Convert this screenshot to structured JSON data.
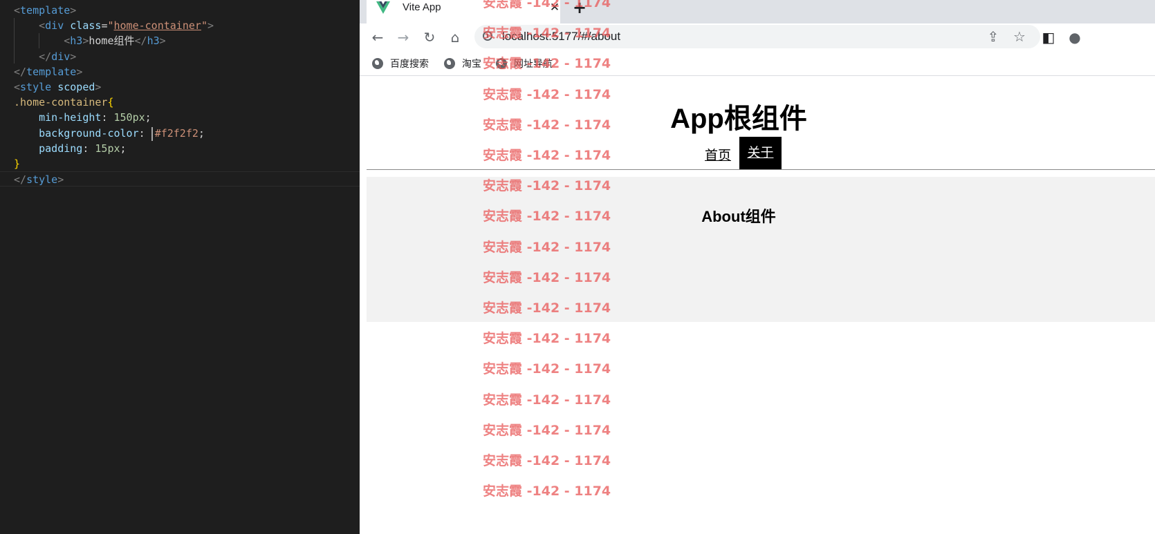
{
  "editor": {
    "lines": [
      [
        [
          "t-punc",
          "<"
        ],
        [
          "t-tag",
          "template"
        ],
        [
          "t-punc",
          ">"
        ]
      ],
      [
        [
          "t-text",
          "    "
        ],
        [
          "t-punc",
          "<"
        ],
        [
          "t-tag",
          "div"
        ],
        [
          "t-text",
          " "
        ],
        [
          "t-attr",
          "class"
        ],
        [
          "t-text",
          "="
        ],
        [
          "t-strq",
          "\""
        ],
        [
          "t-str",
          "home-container"
        ],
        [
          "t-strq",
          "\""
        ],
        [
          "t-punc",
          ">"
        ]
      ],
      [
        [
          "t-text",
          "        "
        ],
        [
          "t-punc",
          "<"
        ],
        [
          "t-tag",
          "h3"
        ],
        [
          "t-punc",
          ">"
        ],
        [
          "t-text",
          "home组件"
        ],
        [
          "t-punc",
          "</"
        ],
        [
          "t-tag",
          "h3"
        ],
        [
          "t-punc",
          ">"
        ]
      ],
      [
        [
          "t-text",
          "    "
        ],
        [
          "t-punc",
          "</"
        ],
        [
          "t-tag",
          "div"
        ],
        [
          "t-punc",
          ">"
        ]
      ],
      [
        [
          "t-punc",
          "</"
        ],
        [
          "t-tag",
          "template"
        ],
        [
          "t-punc",
          ">"
        ]
      ],
      [
        [
          "t-punc",
          "<"
        ],
        [
          "t-tag",
          "style"
        ],
        [
          "t-text",
          " "
        ],
        [
          "t-attr",
          "scoped"
        ],
        [
          "t-punc",
          ">"
        ]
      ],
      [
        [
          "t-sel",
          ".home-container"
        ],
        [
          "t-brace",
          "{"
        ]
      ],
      [
        [
          "t-text",
          "    "
        ],
        [
          "t-prop",
          "min-height"
        ],
        [
          "t-text",
          ": "
        ],
        [
          "t-num",
          "150px"
        ],
        [
          "t-text",
          ";"
        ]
      ],
      [
        [
          "t-text",
          "    "
        ],
        [
          "t-prop",
          "background-color"
        ],
        [
          "t-text",
          ": "
        ],
        [
          "swatch",
          ""
        ],
        [
          "t-val",
          "#f2f2f2"
        ],
        [
          "t-text",
          ";"
        ]
      ],
      [
        [
          "t-text",
          "    "
        ],
        [
          "t-prop",
          "padding"
        ],
        [
          "t-text",
          ": "
        ],
        [
          "t-num",
          "15px"
        ],
        [
          "t-text",
          ";"
        ]
      ],
      [
        [
          "t-brace",
          "}"
        ]
      ],
      [
        [
          "t-punc",
          "</"
        ],
        [
          "t-tag",
          "style"
        ],
        [
          "t-punc",
          ">"
        ]
      ]
    ]
  },
  "browser": {
    "tab": {
      "title": "Vite App",
      "close": "✕",
      "new_tab": "+"
    },
    "toolbar": {
      "back": "←",
      "forward": "→",
      "reload": "↻",
      "home": "⌂",
      "url": "localhost:5177/#/about",
      "share": "⇪",
      "star": "☆",
      "sidepanel": "◧",
      "profile": "●"
    },
    "bookmarks": [
      {
        "label": "百度搜索"
      },
      {
        "label": "淘宝"
      },
      {
        "label": "网址导航"
      }
    ]
  },
  "page": {
    "app_title": "App根组件",
    "nav": {
      "home": "首页",
      "about": "关于"
    },
    "about_title": "About组件"
  },
  "watermark": {
    "text": "安志霞 -142 - 1174"
  }
}
